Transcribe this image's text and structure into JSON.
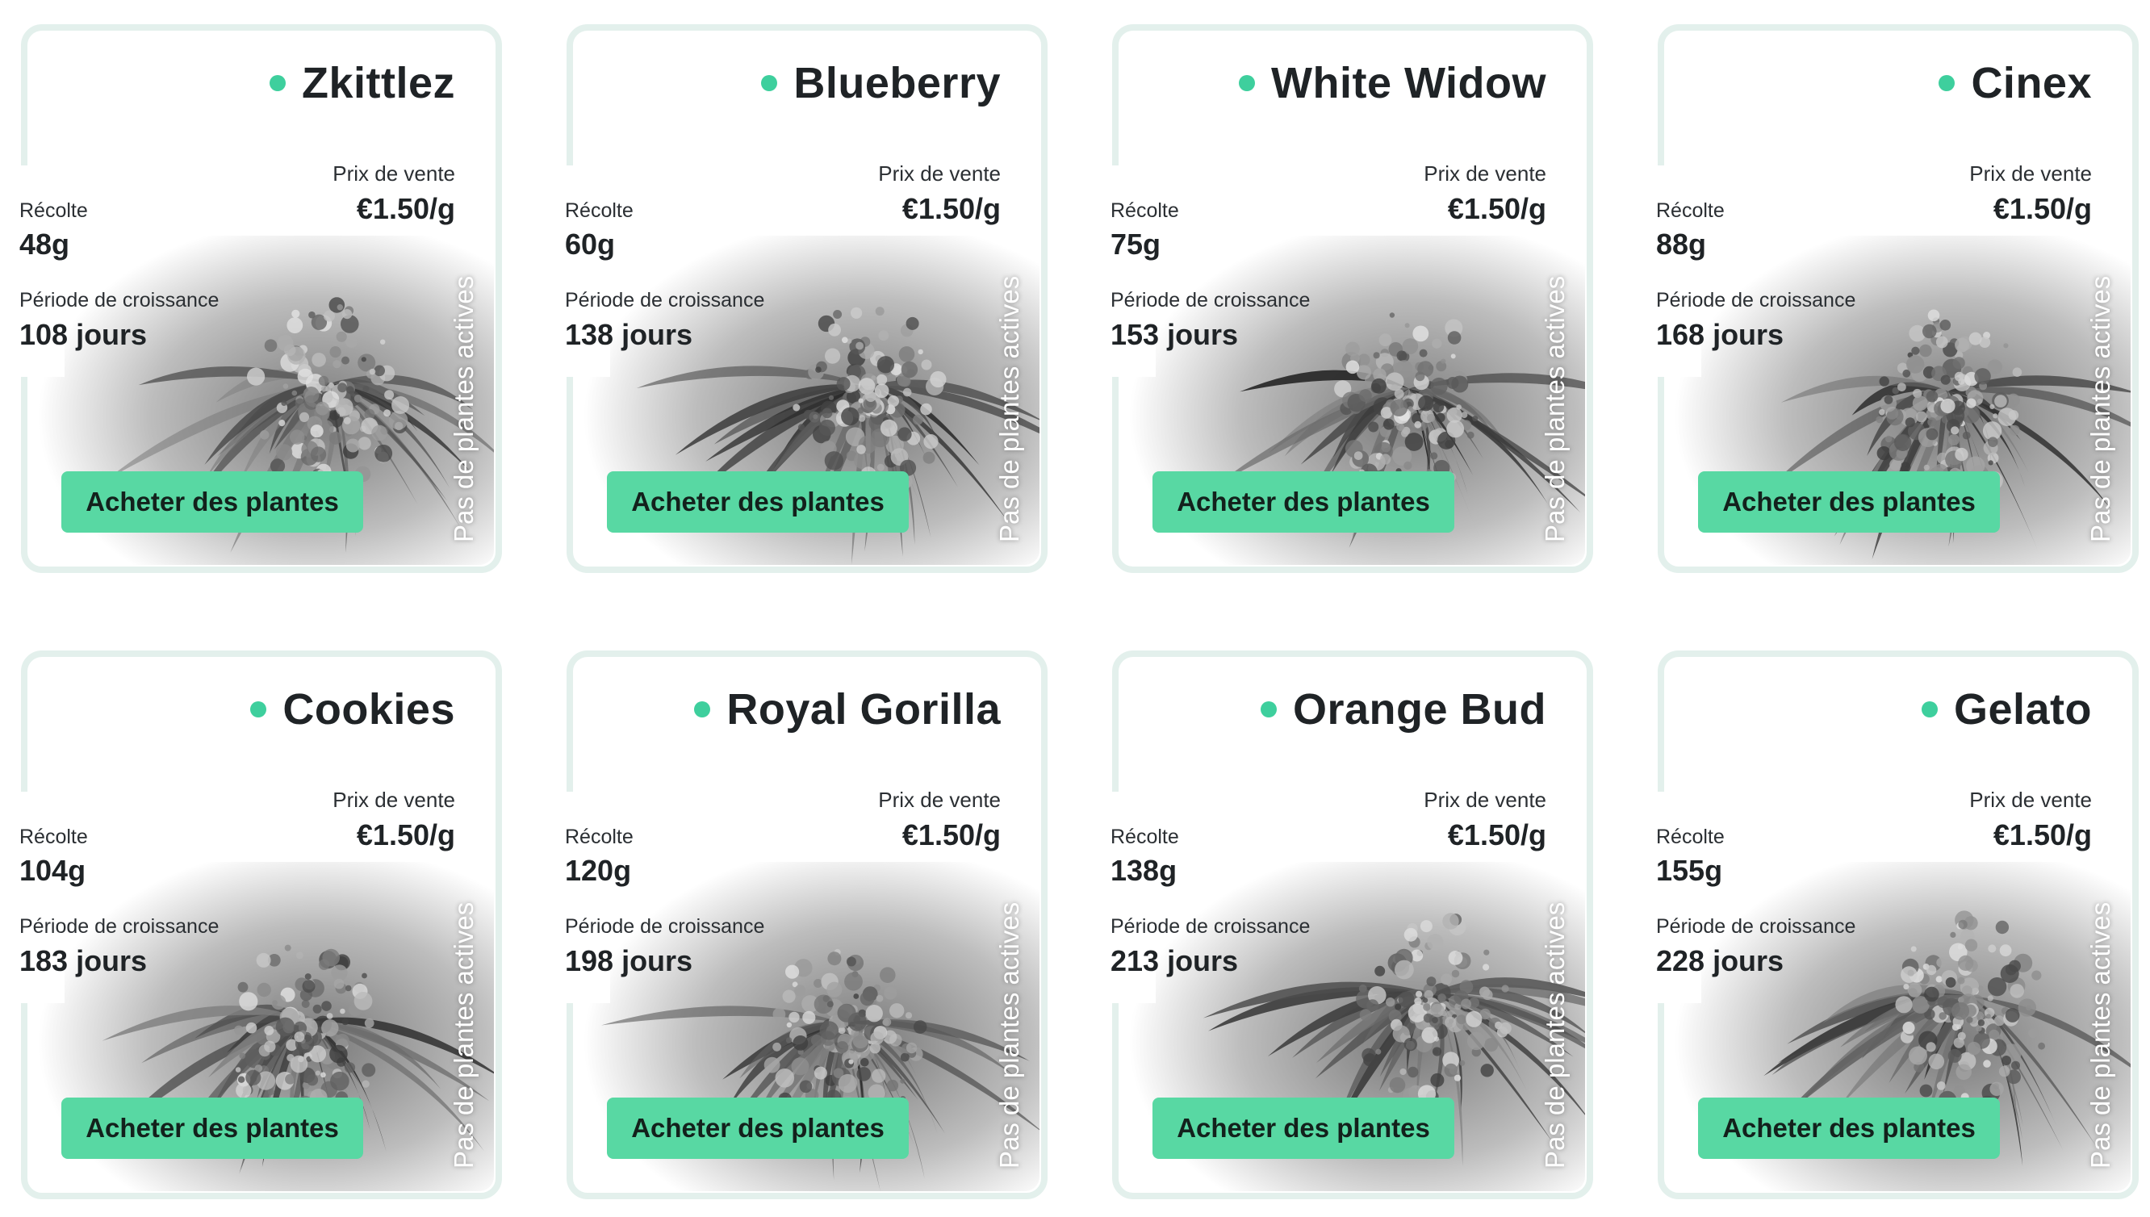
{
  "colors": {
    "accent": "#58d8a3",
    "dot": "#3ecf9d",
    "frame": "#e3f0ec"
  },
  "cards": [
    {
      "name": "Zkittlez",
      "price_label": "Prix de vente",
      "price": "€1.50/g",
      "harvest_label": "Récolte",
      "harvest": "48g",
      "period_label": "Période de croissance",
      "period": "108 jours",
      "button": "Acheter des plantes",
      "status": "Pas de plantes actives"
    },
    {
      "name": "Blueberry",
      "price_label": "Prix de vente",
      "price": "€1.50/g",
      "harvest_label": "Récolte",
      "harvest": "60g",
      "period_label": "Période de croissance",
      "period": "138 jours",
      "button": "Acheter des plantes",
      "status": "Pas de plantes actives"
    },
    {
      "name": "White Widow",
      "price_label": "Prix de vente",
      "price": "€1.50/g",
      "harvest_label": "Récolte",
      "harvest": "75g",
      "period_label": "Période de croissance",
      "period": "153 jours",
      "button": "Acheter des plantes",
      "status": "Pas de plantes actives"
    },
    {
      "name": "Cinex",
      "price_label": "Prix de vente",
      "price": "€1.50/g",
      "harvest_label": "Récolte",
      "harvest": "88g",
      "period_label": "Période de croissance",
      "period": "168 jours",
      "button": "Acheter des plantes",
      "status": "Pas de plantes actives"
    },
    {
      "name": "Cookies",
      "price_label": "Prix de vente",
      "price": "€1.50/g",
      "harvest_label": "Récolte",
      "harvest": "104g",
      "period_label": "Période de croissance",
      "period": "183 jours",
      "button": "Acheter des plantes",
      "status": "Pas de plantes actives"
    },
    {
      "name": "Royal Gorilla",
      "price_label": "Prix de vente",
      "price": "€1.50/g",
      "harvest_label": "Récolte",
      "harvest": "120g",
      "period_label": "Période de croissance",
      "period": "198 jours",
      "button": "Acheter des plantes",
      "status": "Pas de plantes actives"
    },
    {
      "name": "Orange Bud",
      "price_label": "Prix de vente",
      "price": "€1.50/g",
      "harvest_label": "Récolte",
      "harvest": "138g",
      "period_label": "Période de croissance",
      "period": "213 jours",
      "button": "Acheter des plantes",
      "status": "Pas de plantes actives"
    },
    {
      "name": "Gelato",
      "price_label": "Prix de vente",
      "price": "€1.50/g",
      "harvest_label": "Récolte",
      "harvest": "155g",
      "period_label": "Période de croissance",
      "period": "228 jours",
      "button": "Acheter des plantes",
      "status": "Pas de plantes actives"
    }
  ]
}
